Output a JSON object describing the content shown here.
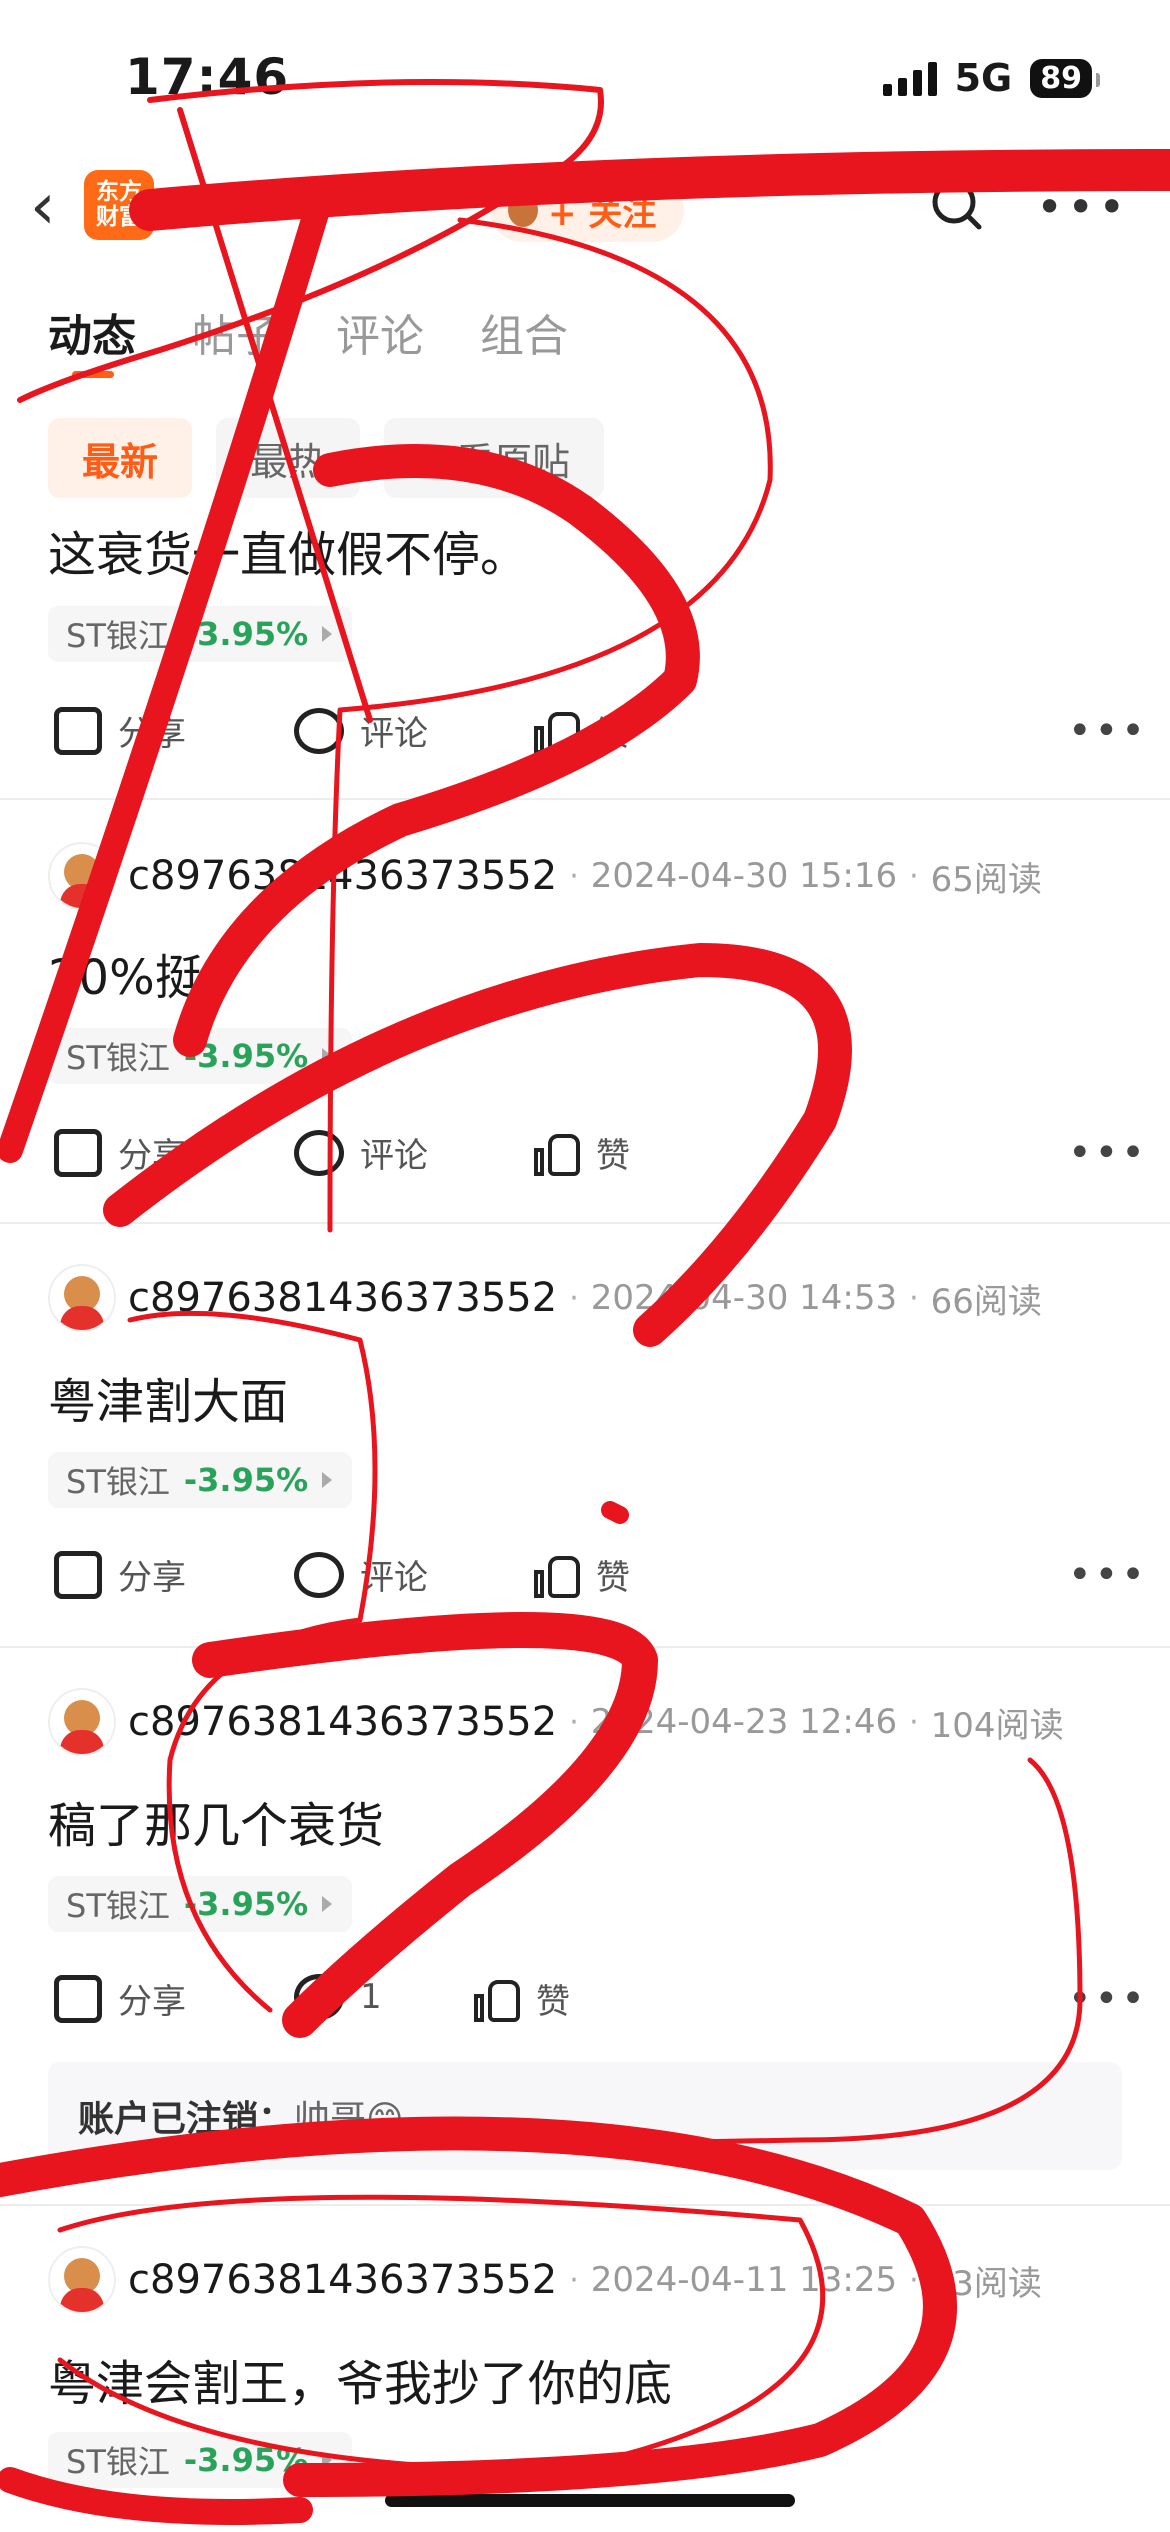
{
  "status_bar": {
    "time": "17:46",
    "network": "5G",
    "battery": "89"
  },
  "nav": {
    "logo": [
      "东方",
      "财富"
    ],
    "follow_label": "+ 关注"
  },
  "tabs": [
    {
      "label": "动态"
    },
    {
      "label": "帖子"
    },
    {
      "label": "评论"
    },
    {
      "label": "组合"
    }
  ],
  "filters": [
    {
      "label": "最新"
    },
    {
      "label": "最热"
    },
    {
      "label": "只看原贴"
    }
  ],
  "posts": [
    {
      "username": "",
      "date": "",
      "reads": "",
      "text": "这衰货一直做假不停。",
      "stock": "ST银江",
      "change": "-3.95%",
      "share": "分享",
      "comment": "评论",
      "like": "赞"
    },
    {
      "username": "c8976381436373552",
      "date": "2024-04-30 15:16",
      "reads": "65阅读",
      "text": "20%挺",
      "stock": "ST银江",
      "change": "-3.95%",
      "share": "分享",
      "comment": "评论",
      "like": "赞"
    },
    {
      "username": "c8976381436373552",
      "date": "2024-04-30 14:53",
      "reads": "66阅读",
      "text": "粤津割大面",
      "stock": "ST银江",
      "change": "-3.95%",
      "share": "分享",
      "comment": "评论",
      "like": "赞"
    },
    {
      "username": "c8976381436373552",
      "date": "2024-04-23 12:46",
      "reads": "104阅读",
      "text": "稿了那几个衰货",
      "stock": "ST银江",
      "change": "-3.95%",
      "share": "分享",
      "comment": "1",
      "like": "赞",
      "reply": {
        "user": "账户已注销：",
        "text": "帅哥😊"
      }
    },
    {
      "username": "c8976381436373552",
      "date": "2024-04-11 13:25",
      "reads": "83阅读",
      "text": "粤津会割王，爷我抄了你的底",
      "stock": "ST银江",
      "change": "-3.95%"
    }
  ],
  "colors": {
    "accent": "#ff5c16",
    "down_green": "#29a35a",
    "scribble_red": "#e8141e"
  }
}
